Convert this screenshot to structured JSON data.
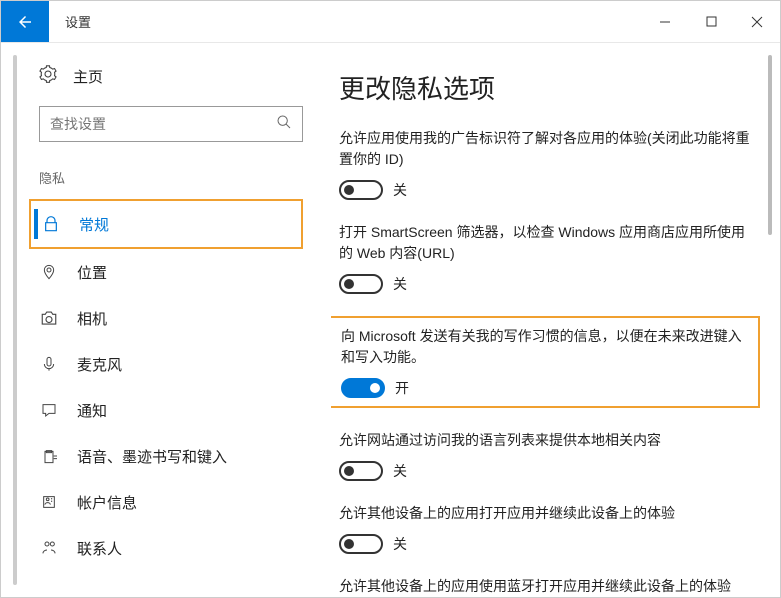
{
  "titlebar": {
    "title": "设置"
  },
  "sidebar": {
    "home": "主页",
    "search_placeholder": "查找设置",
    "section": "隐私",
    "items": [
      {
        "label": "常规"
      },
      {
        "label": "位置"
      },
      {
        "label": "相机"
      },
      {
        "label": "麦克风"
      },
      {
        "label": "通知"
      },
      {
        "label": "语音、墨迹书写和键入"
      },
      {
        "label": "帐户信息"
      },
      {
        "label": "联系人"
      }
    ]
  },
  "content": {
    "heading": "更改隐私选项",
    "options": [
      {
        "text": "允许应用使用我的广告标识符了解对各应用的体验(关闭此功能将重置你的 ID)",
        "state": "关",
        "on": false
      },
      {
        "text": "打开 SmartScreen 筛选器，以检查 Windows 应用商店应用所使用的 Web 内容(URL)",
        "state": "关",
        "on": false
      },
      {
        "text": "向 Microsoft 发送有关我的写作习惯的信息，以便在未来改进键入和写入功能。",
        "state": "开",
        "on": true
      },
      {
        "text": "允许网站通过访问我的语言列表来提供本地相关内容",
        "state": "关",
        "on": false
      },
      {
        "text": "允许其他设备上的应用打开应用并继续此设备上的体验",
        "state": "关",
        "on": false
      },
      {
        "text": "允许其他设备上的应用使用蓝牙打开应用并继续此设备上的体验",
        "state": "",
        "on": false
      }
    ]
  }
}
